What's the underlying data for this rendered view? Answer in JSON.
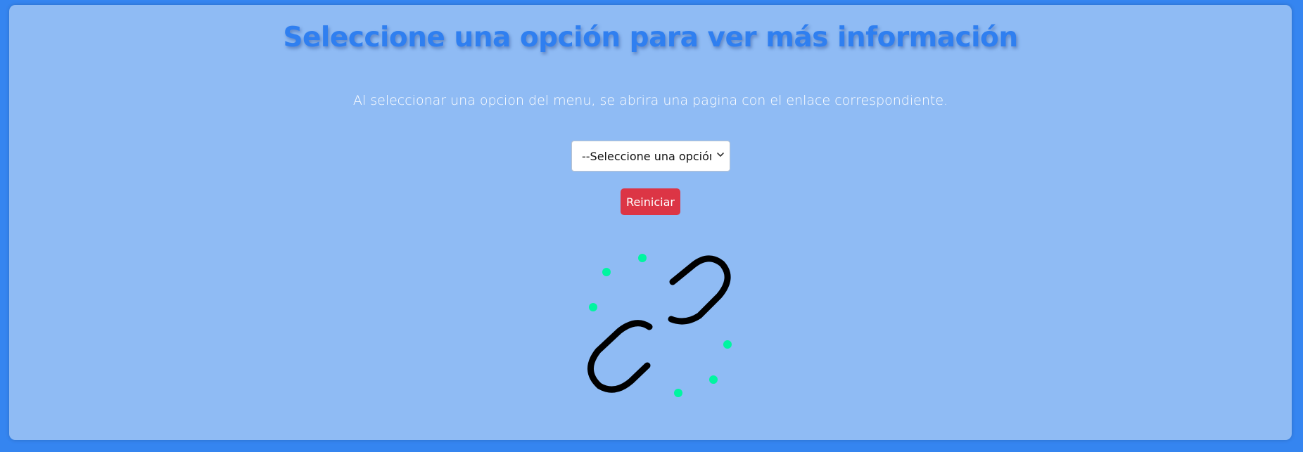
{
  "page": {
    "title": "Seleccione una opción para ver más información",
    "description": "Al seleccionar una opcion del menu, se abrira una pagina con el enlace correspondiente."
  },
  "menu": {
    "selected": "--Seleccione una opción--",
    "options": [
      "--Seleccione una opción--"
    ]
  },
  "reset_button": {
    "label": "Reiniciar",
    "color": "#dc3545"
  },
  "illustration": {
    "icon": "broken-link-icon",
    "link_color": "#000000",
    "spark_color": "#00f5a0"
  },
  "colors": {
    "background": "#3585f0",
    "panel": "#8fbbf4",
    "title": "#2f7ff0",
    "text": "#ffffff"
  }
}
